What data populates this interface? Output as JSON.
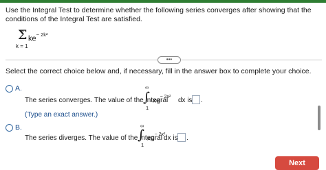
{
  "prompt": "Use the Integral Test to determine whether the following series converges after showing that the conditions of the Integral Test are satisfied.",
  "series": {
    "upper": "∞",
    "sigma": "Σ",
    "lower": "k = 1",
    "term_base": "ke",
    "term_exponent": "− 2k²"
  },
  "more_label": "•••",
  "instruction": "Select the correct choice below and, if necessary, fill in the answer box to complete your choice.",
  "option_a": {
    "letter": "A.",
    "text": "The series converges. The value of the integral",
    "upper": "∞",
    "lower": "1",
    "integral_sign": "∫",
    "integrand_base": "xe",
    "integrand_exponent": "− 2x²",
    "dx": "dx is",
    "period": ".",
    "hint": "(Type an exact answer.)"
  },
  "option_b": {
    "letter": "B.",
    "text": "The series diverges. The value of the integral",
    "upper": "∞",
    "lower": "1",
    "integral_sign": "∫",
    "integrand_base": "xe",
    "integrand_exponent": "− 2x²",
    "dx": "dx is",
    "period": "."
  },
  "next_label": "Next",
  "colors": {
    "accent_bar": "#2e7d32",
    "link_blue": "#1a4d8c",
    "next_button": "#d64a3f"
  }
}
